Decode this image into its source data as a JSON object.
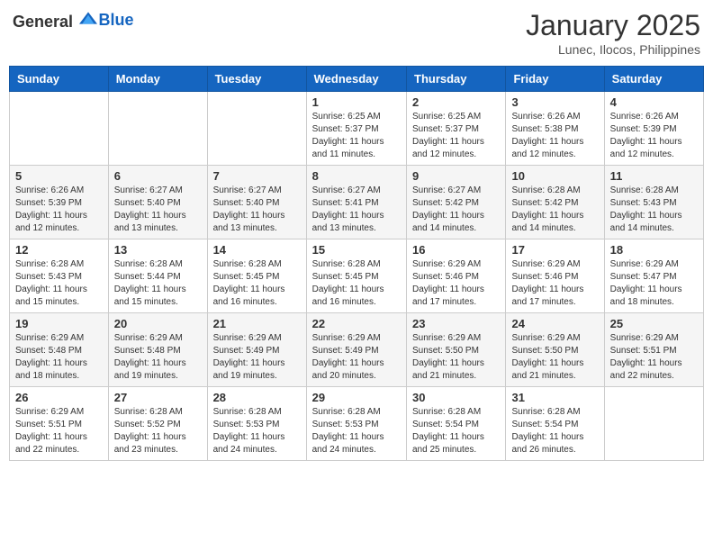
{
  "header": {
    "logo_general": "General",
    "logo_blue": "Blue",
    "month_title": "January 2025",
    "location": "Lunec, Ilocos, Philippines"
  },
  "weekdays": [
    "Sunday",
    "Monday",
    "Tuesday",
    "Wednesday",
    "Thursday",
    "Friday",
    "Saturday"
  ],
  "weeks": [
    [
      {
        "day": "",
        "sunrise": "",
        "sunset": "",
        "daylight": ""
      },
      {
        "day": "",
        "sunrise": "",
        "sunset": "",
        "daylight": ""
      },
      {
        "day": "",
        "sunrise": "",
        "sunset": "",
        "daylight": ""
      },
      {
        "day": "1",
        "sunrise": "Sunrise: 6:25 AM",
        "sunset": "Sunset: 5:37 PM",
        "daylight": "Daylight: 11 hours and 11 minutes."
      },
      {
        "day": "2",
        "sunrise": "Sunrise: 6:25 AM",
        "sunset": "Sunset: 5:37 PM",
        "daylight": "Daylight: 11 hours and 12 minutes."
      },
      {
        "day": "3",
        "sunrise": "Sunrise: 6:26 AM",
        "sunset": "Sunset: 5:38 PM",
        "daylight": "Daylight: 11 hours and 12 minutes."
      },
      {
        "day": "4",
        "sunrise": "Sunrise: 6:26 AM",
        "sunset": "Sunset: 5:39 PM",
        "daylight": "Daylight: 11 hours and 12 minutes."
      }
    ],
    [
      {
        "day": "5",
        "sunrise": "Sunrise: 6:26 AM",
        "sunset": "Sunset: 5:39 PM",
        "daylight": "Daylight: 11 hours and 12 minutes."
      },
      {
        "day": "6",
        "sunrise": "Sunrise: 6:27 AM",
        "sunset": "Sunset: 5:40 PM",
        "daylight": "Daylight: 11 hours and 13 minutes."
      },
      {
        "day": "7",
        "sunrise": "Sunrise: 6:27 AM",
        "sunset": "Sunset: 5:40 PM",
        "daylight": "Daylight: 11 hours and 13 minutes."
      },
      {
        "day": "8",
        "sunrise": "Sunrise: 6:27 AM",
        "sunset": "Sunset: 5:41 PM",
        "daylight": "Daylight: 11 hours and 13 minutes."
      },
      {
        "day": "9",
        "sunrise": "Sunrise: 6:27 AM",
        "sunset": "Sunset: 5:42 PM",
        "daylight": "Daylight: 11 hours and 14 minutes."
      },
      {
        "day": "10",
        "sunrise": "Sunrise: 6:28 AM",
        "sunset": "Sunset: 5:42 PM",
        "daylight": "Daylight: 11 hours and 14 minutes."
      },
      {
        "day": "11",
        "sunrise": "Sunrise: 6:28 AM",
        "sunset": "Sunset: 5:43 PM",
        "daylight": "Daylight: 11 hours and 14 minutes."
      }
    ],
    [
      {
        "day": "12",
        "sunrise": "Sunrise: 6:28 AM",
        "sunset": "Sunset: 5:43 PM",
        "daylight": "Daylight: 11 hours and 15 minutes."
      },
      {
        "day": "13",
        "sunrise": "Sunrise: 6:28 AM",
        "sunset": "Sunset: 5:44 PM",
        "daylight": "Daylight: 11 hours and 15 minutes."
      },
      {
        "day": "14",
        "sunrise": "Sunrise: 6:28 AM",
        "sunset": "Sunset: 5:45 PM",
        "daylight": "Daylight: 11 hours and 16 minutes."
      },
      {
        "day": "15",
        "sunrise": "Sunrise: 6:28 AM",
        "sunset": "Sunset: 5:45 PM",
        "daylight": "Daylight: 11 hours and 16 minutes."
      },
      {
        "day": "16",
        "sunrise": "Sunrise: 6:29 AM",
        "sunset": "Sunset: 5:46 PM",
        "daylight": "Daylight: 11 hours and 17 minutes."
      },
      {
        "day": "17",
        "sunrise": "Sunrise: 6:29 AM",
        "sunset": "Sunset: 5:46 PM",
        "daylight": "Daylight: 11 hours and 17 minutes."
      },
      {
        "day": "18",
        "sunrise": "Sunrise: 6:29 AM",
        "sunset": "Sunset: 5:47 PM",
        "daylight": "Daylight: 11 hours and 18 minutes."
      }
    ],
    [
      {
        "day": "19",
        "sunrise": "Sunrise: 6:29 AM",
        "sunset": "Sunset: 5:48 PM",
        "daylight": "Daylight: 11 hours and 18 minutes."
      },
      {
        "day": "20",
        "sunrise": "Sunrise: 6:29 AM",
        "sunset": "Sunset: 5:48 PM",
        "daylight": "Daylight: 11 hours and 19 minutes."
      },
      {
        "day": "21",
        "sunrise": "Sunrise: 6:29 AM",
        "sunset": "Sunset: 5:49 PM",
        "daylight": "Daylight: 11 hours and 19 minutes."
      },
      {
        "day": "22",
        "sunrise": "Sunrise: 6:29 AM",
        "sunset": "Sunset: 5:49 PM",
        "daylight": "Daylight: 11 hours and 20 minutes."
      },
      {
        "day": "23",
        "sunrise": "Sunrise: 6:29 AM",
        "sunset": "Sunset: 5:50 PM",
        "daylight": "Daylight: 11 hours and 21 minutes."
      },
      {
        "day": "24",
        "sunrise": "Sunrise: 6:29 AM",
        "sunset": "Sunset: 5:50 PM",
        "daylight": "Daylight: 11 hours and 21 minutes."
      },
      {
        "day": "25",
        "sunrise": "Sunrise: 6:29 AM",
        "sunset": "Sunset: 5:51 PM",
        "daylight": "Daylight: 11 hours and 22 minutes."
      }
    ],
    [
      {
        "day": "26",
        "sunrise": "Sunrise: 6:29 AM",
        "sunset": "Sunset: 5:51 PM",
        "daylight": "Daylight: 11 hours and 22 minutes."
      },
      {
        "day": "27",
        "sunrise": "Sunrise: 6:28 AM",
        "sunset": "Sunset: 5:52 PM",
        "daylight": "Daylight: 11 hours and 23 minutes."
      },
      {
        "day": "28",
        "sunrise": "Sunrise: 6:28 AM",
        "sunset": "Sunset: 5:53 PM",
        "daylight": "Daylight: 11 hours and 24 minutes."
      },
      {
        "day": "29",
        "sunrise": "Sunrise: 6:28 AM",
        "sunset": "Sunset: 5:53 PM",
        "daylight": "Daylight: 11 hours and 24 minutes."
      },
      {
        "day": "30",
        "sunrise": "Sunrise: 6:28 AM",
        "sunset": "Sunset: 5:54 PM",
        "daylight": "Daylight: 11 hours and 25 minutes."
      },
      {
        "day": "31",
        "sunrise": "Sunrise: 6:28 AM",
        "sunset": "Sunset: 5:54 PM",
        "daylight": "Daylight: 11 hours and 26 minutes."
      },
      {
        "day": "",
        "sunrise": "",
        "sunset": "",
        "daylight": ""
      }
    ]
  ]
}
